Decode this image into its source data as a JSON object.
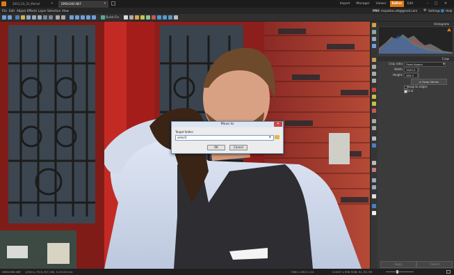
{
  "doc_tabs": [
    {
      "label": "2013_03_31_Michal"
    },
    {
      "label": "DMD4360.NEF"
    }
  ],
  "mode_tabs": [
    {
      "label": "Import"
    },
    {
      "label": "Manager"
    },
    {
      "label": "Viewer"
    },
    {
      "label": "Editor"
    },
    {
      "label": "Edit"
    }
  ],
  "active_mode": "Editor",
  "menu": [
    "File",
    "Edit",
    "Adjust",
    "Effects",
    "Layer",
    "Selection",
    "View"
  ],
  "menu_right": {
    "pro": "PRO",
    "email": "mspatlas.ott@gmail.com",
    "settings": "Settings",
    "help": "Help"
  },
  "toolbar": {
    "quick_fix": "Quick Fix"
  },
  "histogram": {
    "title": "Histogram"
  },
  "crop": {
    "title": "Crop",
    "ratio_label": "Crop ratio:",
    "ratio_value": "Fixed Aspect",
    "width_label": "Width:",
    "width_value": "1920.0",
    "height_label": "Height:",
    "height_value": "480.0",
    "swap_label": "Swap Values",
    "snap_label": "Snap to edges",
    "grid_label": "Grid"
  },
  "panel_bottom": {
    "apply": "Apply",
    "cancel": "Cancel"
  },
  "status": {
    "filename": "DMD4360.NEF",
    "info": "1/320 s, F5.6, ISO 160, f=23.00 mm",
    "dims": "7360 x 4912 x 24",
    "coords": "0.0007 x 936",
    "rgb": "RGB: 91, 93, 99"
  },
  "dialog": {
    "title": "Move to",
    "field_label": "Target folder:",
    "field_value": "selecO",
    "ok": "OK",
    "cancel": "Cancel"
  },
  "colors": {
    "accent": "#e07a10",
    "panel": "#3b3b3b",
    "dialog_bg": "#ececec",
    "dialog_title": "#dce6f2",
    "dialog_close": "#c9463d"
  }
}
